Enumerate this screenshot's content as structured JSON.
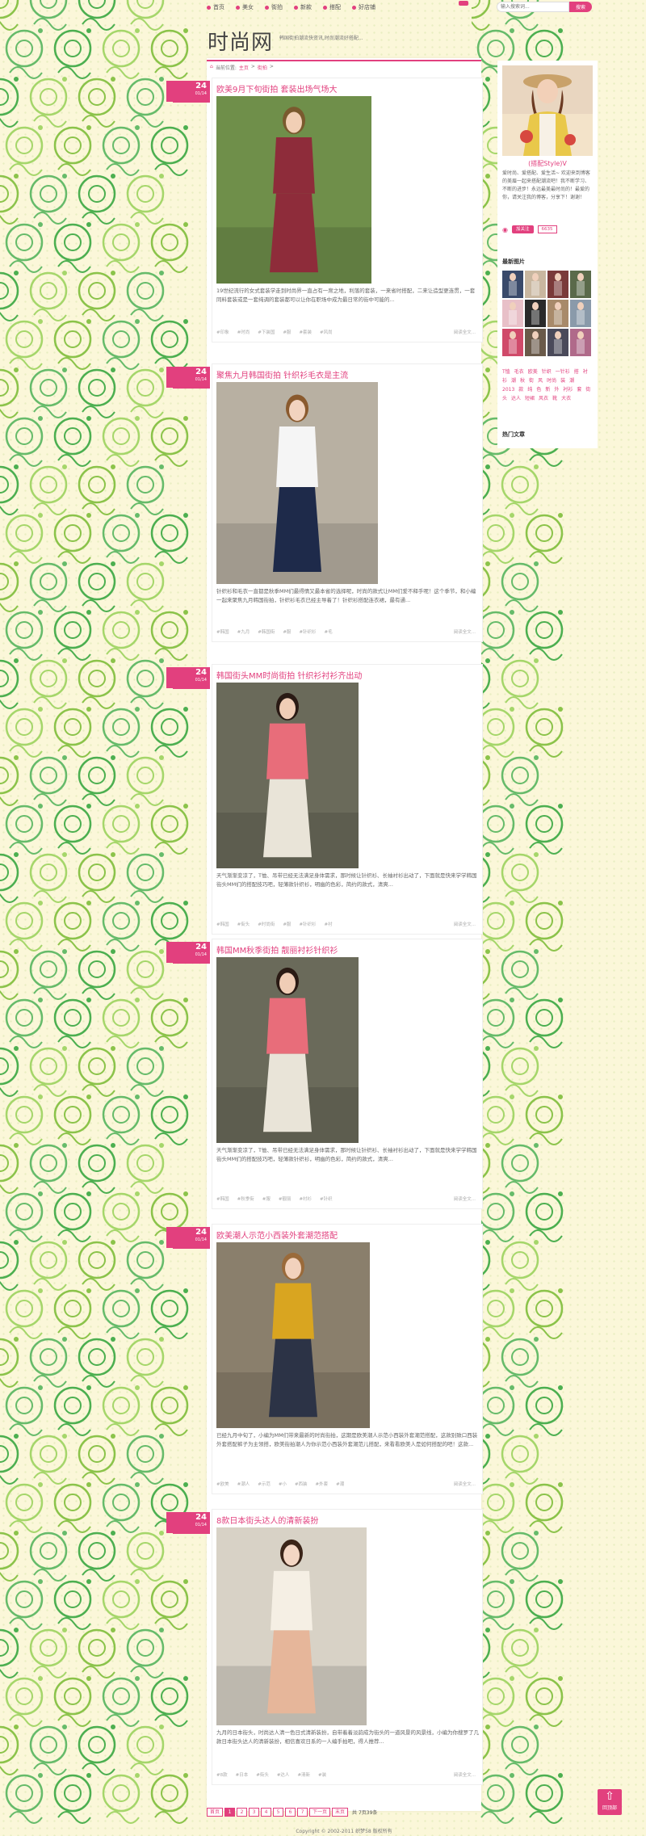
{
  "nav": {
    "items": [
      {
        "label": "首页"
      },
      {
        "label": "美女"
      },
      {
        "label": "街拍"
      },
      {
        "label": "新款"
      },
      {
        "label": "搭配"
      },
      {
        "label": "好店铺"
      }
    ],
    "search_placeholder": "输入搜索词...",
    "search_button": "搜索"
  },
  "header": {
    "logo": "时尚网",
    "tagline": "韩国街拍潮流快资讯,时尚潮流好搭配..."
  },
  "breadcrumb": {
    "prefix": "当前位置:",
    "home": "主页",
    "separator": ">",
    "current": "街拍",
    "trail": ">"
  },
  "posts": [
    {
      "day": "24",
      "month_day": "01/14",
      "title": "欧美9月下旬街拍 套装出场气场大",
      "excerpt": "19世纪流行的女式套装学走到时尚界一直占有一席之地，利落的套装，一来省时搭配，二来让造型更连贯，一套同料套装或是一套纯调的套装都可以让你在职场中成为最日常的街中可能的...",
      "tags": [
        "#印象",
        "#时尚",
        "#下装国",
        "#服",
        "#套装",
        "#风尚"
      ],
      "read_more": "阅读全文..."
    },
    {
      "day": "24",
      "month_day": "01/14",
      "title": "聚焦九月韩国街拍 针织衫毛衣是主流",
      "excerpt": "针织衫和毛衣一直都是秋季MM们最得情又最本省的选择呢，时尚的款式让MM们爱不释手呢！这个季节，和小编一起来聚焦九月韩国街拍，针织衫毛衣已经主导着了！针织衫搭配连衣裙，最有通...",
      "tags": [
        "#韩国",
        "#九月",
        "#韩国街",
        "#服",
        "#针织衫",
        "#毛"
      ],
      "read_more": "阅读全文..."
    },
    {
      "day": "24",
      "month_day": "01/14",
      "title": "韩国街头MM时尚街拍 针织衫衬衫齐出动",
      "excerpt": "天气渐渐变凉了，T恤、吊带已经无法满足身体需求，那时候让针织衫、长袖衬衫出动了，下面就是快来学学韩国街头MM们的搭配技巧吧，轻薄款针织衫，明幽的色彩，简约的款式，清爽...",
      "tags": [
        "#韩国",
        "#街头",
        "#时尚街",
        "#服",
        "#针织衫",
        "#衬"
      ],
      "read_more": "阅读全文..."
    },
    {
      "day": "24",
      "month_day": "01/14",
      "title": "韩国MM秋季街拍 靓丽衬衫针织衫",
      "excerpt": "天气渐渐变凉了，T恤、吊带已经无法满足身体需求，那时候让针织衫、长袖衬衫出动了，下面就是快来学学韩国街头MM们的搭配技巧吧，轻薄款针织衫，明幽的色彩，简约的款式，清爽...",
      "tags": [
        "#韩国",
        "#秋季街",
        "#服",
        "#靓丽",
        "#衬衫",
        "#针织"
      ],
      "read_more": "阅读全文..."
    },
    {
      "day": "24",
      "month_day": "01/14",
      "title": "欧美潮人示范小西装外套潮范搭配",
      "excerpt": "已经九月中旬了，小编为MM们带来最新的时尚街拍，这期是欧美潮人示范小西装外套潮范搭配，这款别致口西装外套搭配裤子为主领搭，欧美街拍潮人为你示范小西装外套潮范儿搭配，来看看欧美人是如何搭配的吧！这款...",
      "tags": [
        "#欧美",
        "#潮人",
        "#示范",
        "#小",
        "#西装",
        "#外套",
        "#潮"
      ],
      "read_more": "阅读全文..."
    },
    {
      "day": "24",
      "month_day": "01/14",
      "title": "8款日本街头达人的清新装扮",
      "excerpt": "九月的日本街头，时尚达人清一色日式清新装扮，自带着着淡韵成为街头的一道风景的风景线，小编为你搜罗了几款日本街头达人的清新装扮，相信喜欢日系的一人编手拍吧，得人推荐...",
      "tags": [
        "#8款",
        "#日本",
        "#街头",
        "#达人",
        "#清新",
        "#装"
      ],
      "read_more": "阅读全文..."
    }
  ],
  "sidebar": {
    "profile_name": "(搭配Style)V",
    "bio": "爱时尚、爱搭配、爱生活~ 欢迎来到博客的美眉一起来搭配潮流吧！我不断学习、不断的进步！永远最美最时尚的！最爱的你，请关注我的博客，分享下！谢谢！",
    "follow_label": "加关注",
    "follow_count": "6635",
    "recent_photos_title": "最新图片",
    "tags": [
      "T恤",
      "毛衣",
      "欧美",
      "针织",
      "一针衫",
      "搭",
      "衬衫",
      "潮",
      "秋",
      "街",
      "风",
      "时尚",
      "装",
      "潮",
      "2013",
      "款",
      "纯",
      "色",
      "新",
      "外",
      "衬衫",
      "套",
      "街头",
      "达人",
      "短裙",
      "风衣",
      "靴",
      "大衣"
    ],
    "hot_articles_title": "热门文章"
  },
  "pagination": {
    "first": "首页",
    "pages": [
      "1",
      "2",
      "3",
      "4",
      "5",
      "6",
      "7"
    ],
    "next": "下一页",
    "last": "末页",
    "info": "共 7页39条"
  },
  "footer": {
    "copyright": "Copyright © 2002-2011 织梦58 版权所有"
  },
  "back_to_top": {
    "label": "回顶部"
  },
  "colors": {
    "accent": "#e2407e",
    "background": "#fbf7d9"
  }
}
